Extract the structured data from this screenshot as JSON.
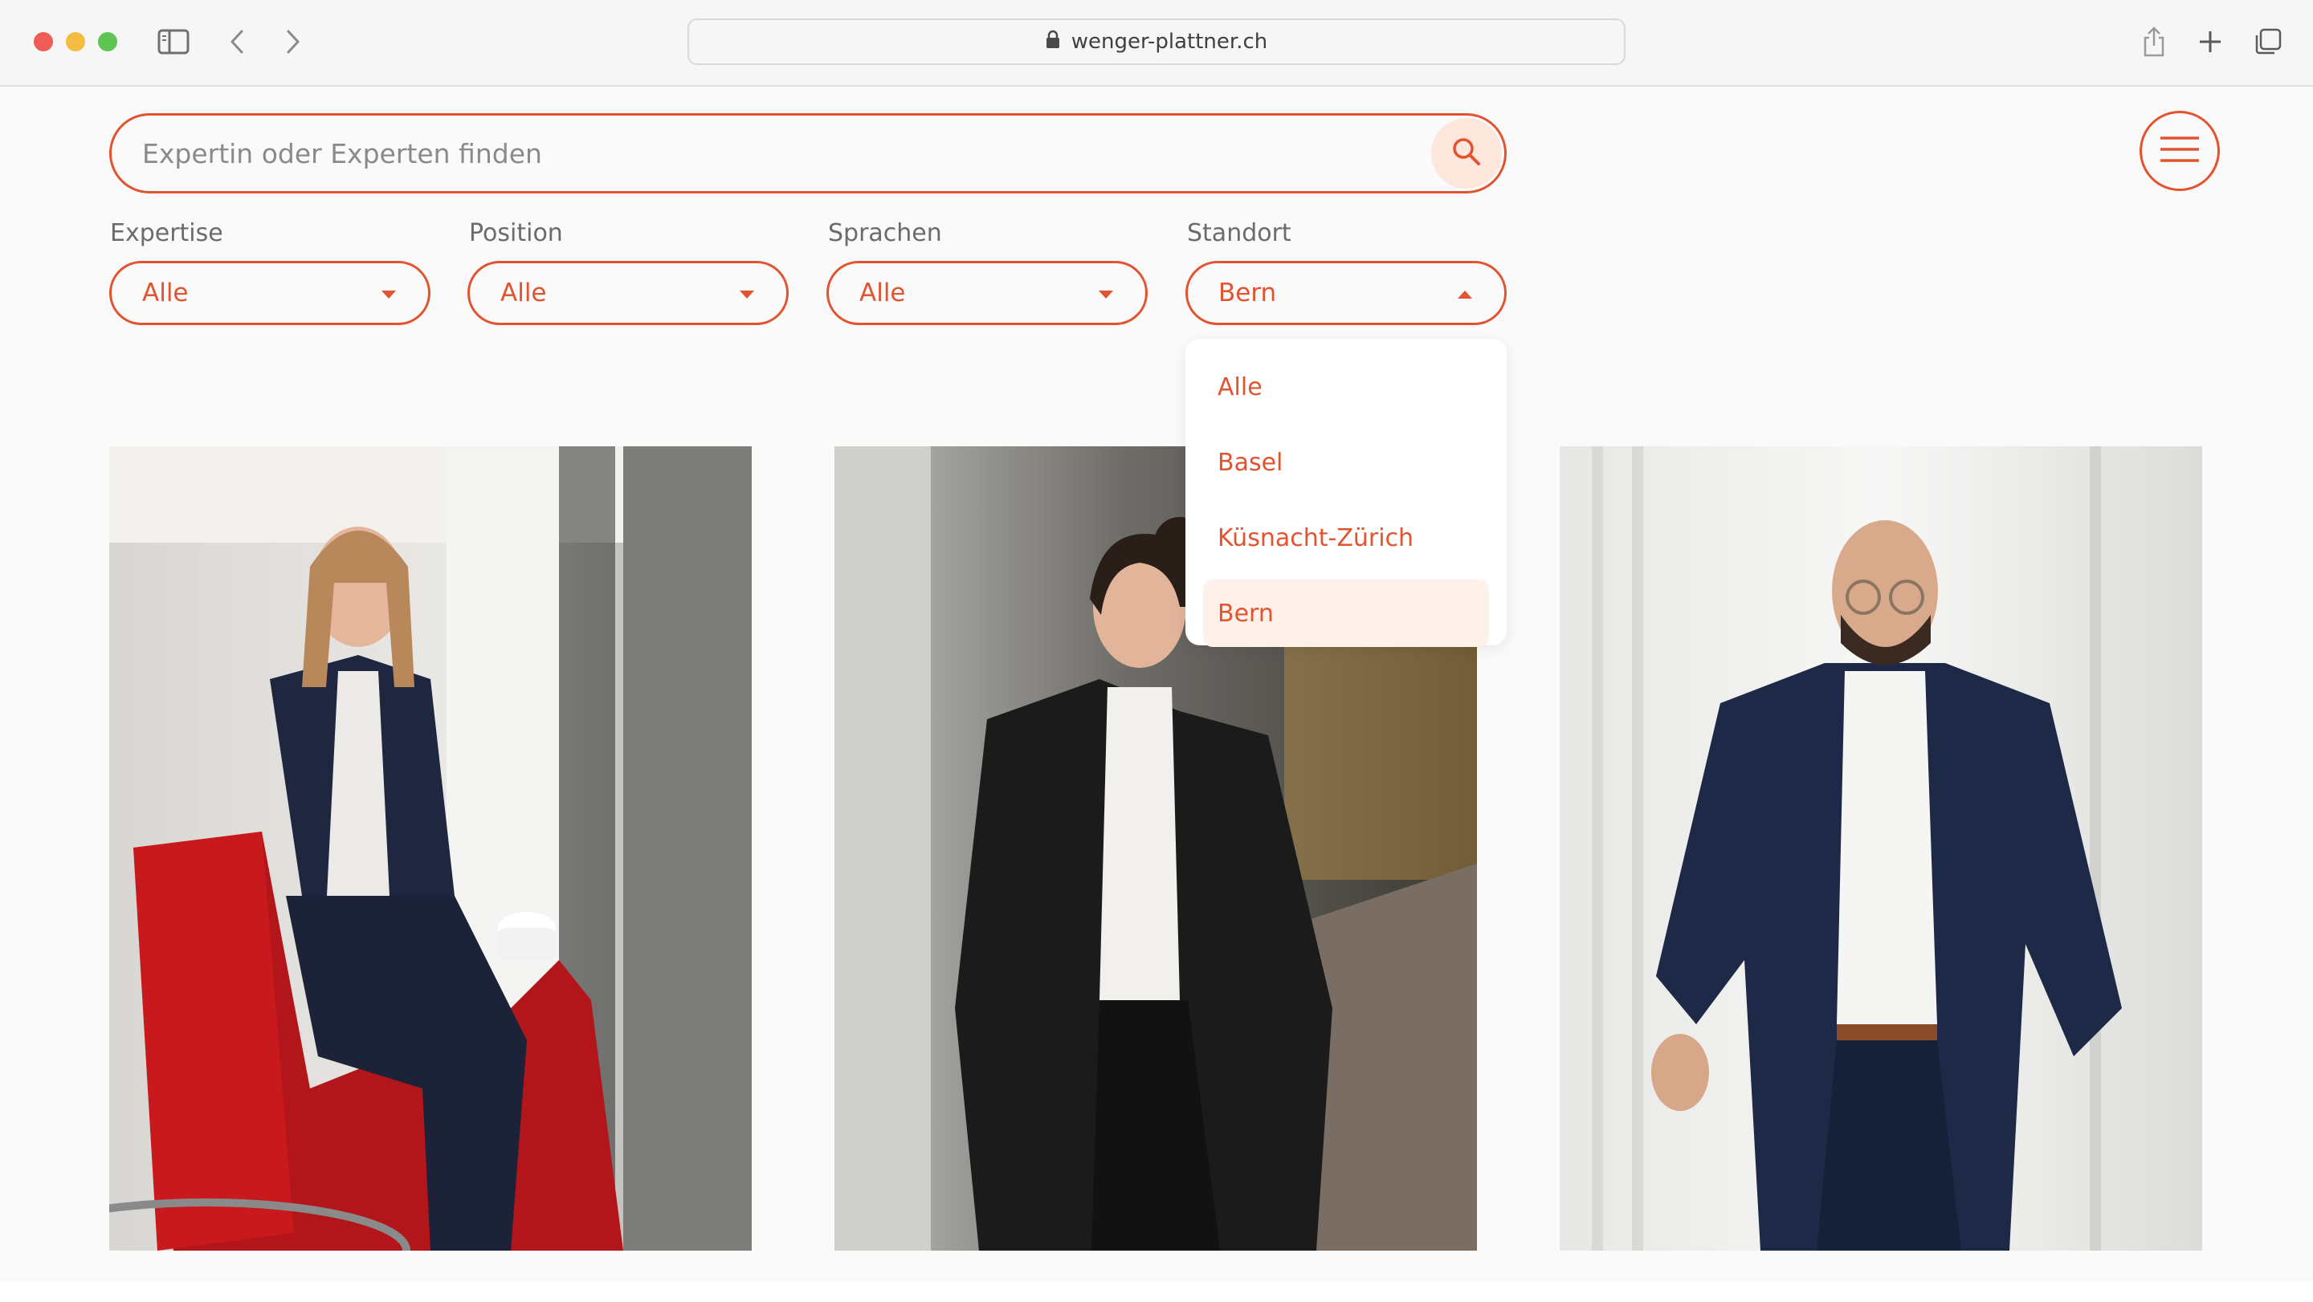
{
  "browser": {
    "url": "wenger-plattner.ch"
  },
  "search": {
    "placeholder": "Expertin oder Experten finden"
  },
  "filters": [
    {
      "label": "Expertise",
      "value": "Alle"
    },
    {
      "label": "Position",
      "value": "Alle"
    },
    {
      "label": "Sprachen",
      "value": "Alle"
    },
    {
      "label": "Standort",
      "value": "Bern"
    }
  ],
  "standort_dropdown": {
    "options": [
      "Alle",
      "Basel",
      "Küsnacht-Zürich",
      "Bern"
    ],
    "selected": "Bern"
  },
  "colors": {
    "accent": "#e2532f",
    "accent_soft": "#fde6dc",
    "background": "#fafafa"
  },
  "icons": {
    "search": "search-icon",
    "menu": "hamburger-menu-icon",
    "lock": "lock-icon",
    "share": "share-icon",
    "new_tab": "plus-icon",
    "tabs": "tabs-overview-icon",
    "sidebar": "sidebar-icon",
    "back": "chevron-left-icon",
    "forward": "chevron-right-icon"
  }
}
